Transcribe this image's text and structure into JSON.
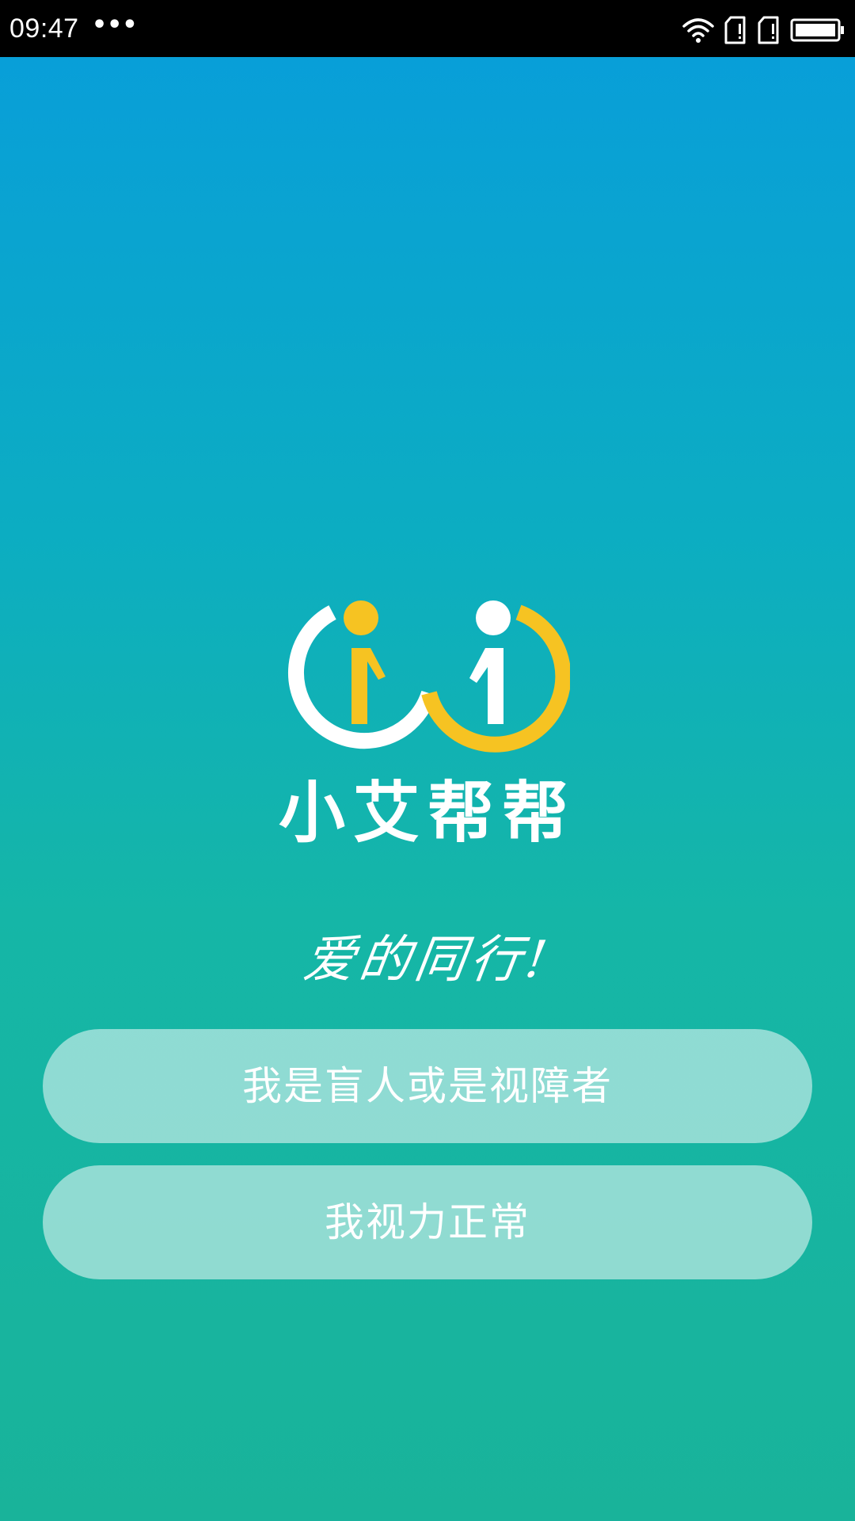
{
  "status_bar": {
    "time": "09:47",
    "more": "•••",
    "icons": [
      "wifi-icon",
      "sim-card-1-icon",
      "sim-card-2-icon",
      "battery-icon"
    ]
  },
  "app": {
    "name": "小艾帮帮",
    "slogan": "爱的同行!"
  },
  "buttons": {
    "blind": "我是盲人或是视障者",
    "sighted": "我视力正常"
  },
  "colors": {
    "gradient_top": "#089ddb",
    "gradient_bottom": "#19b39a",
    "logo_yellow": "#f6c322",
    "logo_white": "#ffffff"
  }
}
